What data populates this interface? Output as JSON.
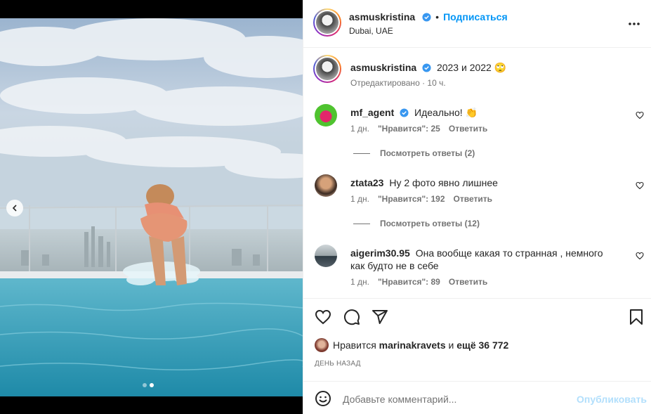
{
  "post": {
    "username": "asmuskristina",
    "follow_label": "Подписаться",
    "separator": "•",
    "location": "Dubai, UAE"
  },
  "caption": {
    "username": "asmuskristina",
    "text": "2023 и 2022 🙄",
    "meta": "Отредактировано · 10 ч."
  },
  "comments": [
    {
      "username": "mf_agent",
      "verified": true,
      "text": "Идеально! 👏",
      "time": "1 дн.",
      "likes": "\"Нравится\": 25",
      "reply": "Ответить",
      "view_replies": "Посмотреть ответы (2)"
    },
    {
      "username": "ztata23",
      "verified": false,
      "text": "Ну 2 фото явно лишнее",
      "time": "1 дн.",
      "likes": "\"Нравится\": 192",
      "reply": "Ответить",
      "view_replies": "Посмотреть ответы (12)"
    },
    {
      "username": "aigerim30.95",
      "verified": false,
      "text": "Она вообще какая то странная , немного как будто не в себе",
      "time": "1 дн.",
      "likes": "\"Нравится\": 89",
      "reply": "Ответить"
    }
  ],
  "likes": {
    "prefix": "Нравится",
    "user": "marinakravets",
    "conj": "и",
    "others": "ещё 36 772"
  },
  "date": "ДЕНЬ НАЗАД",
  "comment_input": {
    "placeholder": "Добавьте комментарий...",
    "publish_label": "Опубликовать"
  },
  "carousel": {
    "total": 2,
    "active": 2
  },
  "colors": {
    "accent": "#0095f6",
    "verified": "#3897f0",
    "muted": "#737373",
    "publish_disabled": "#b2dffc"
  },
  "icons": [
    "chevron-left-icon",
    "more-icon",
    "verified-icon",
    "heart-icon",
    "comment-icon",
    "share-icon",
    "bookmark-icon",
    "emoji-icon"
  ]
}
